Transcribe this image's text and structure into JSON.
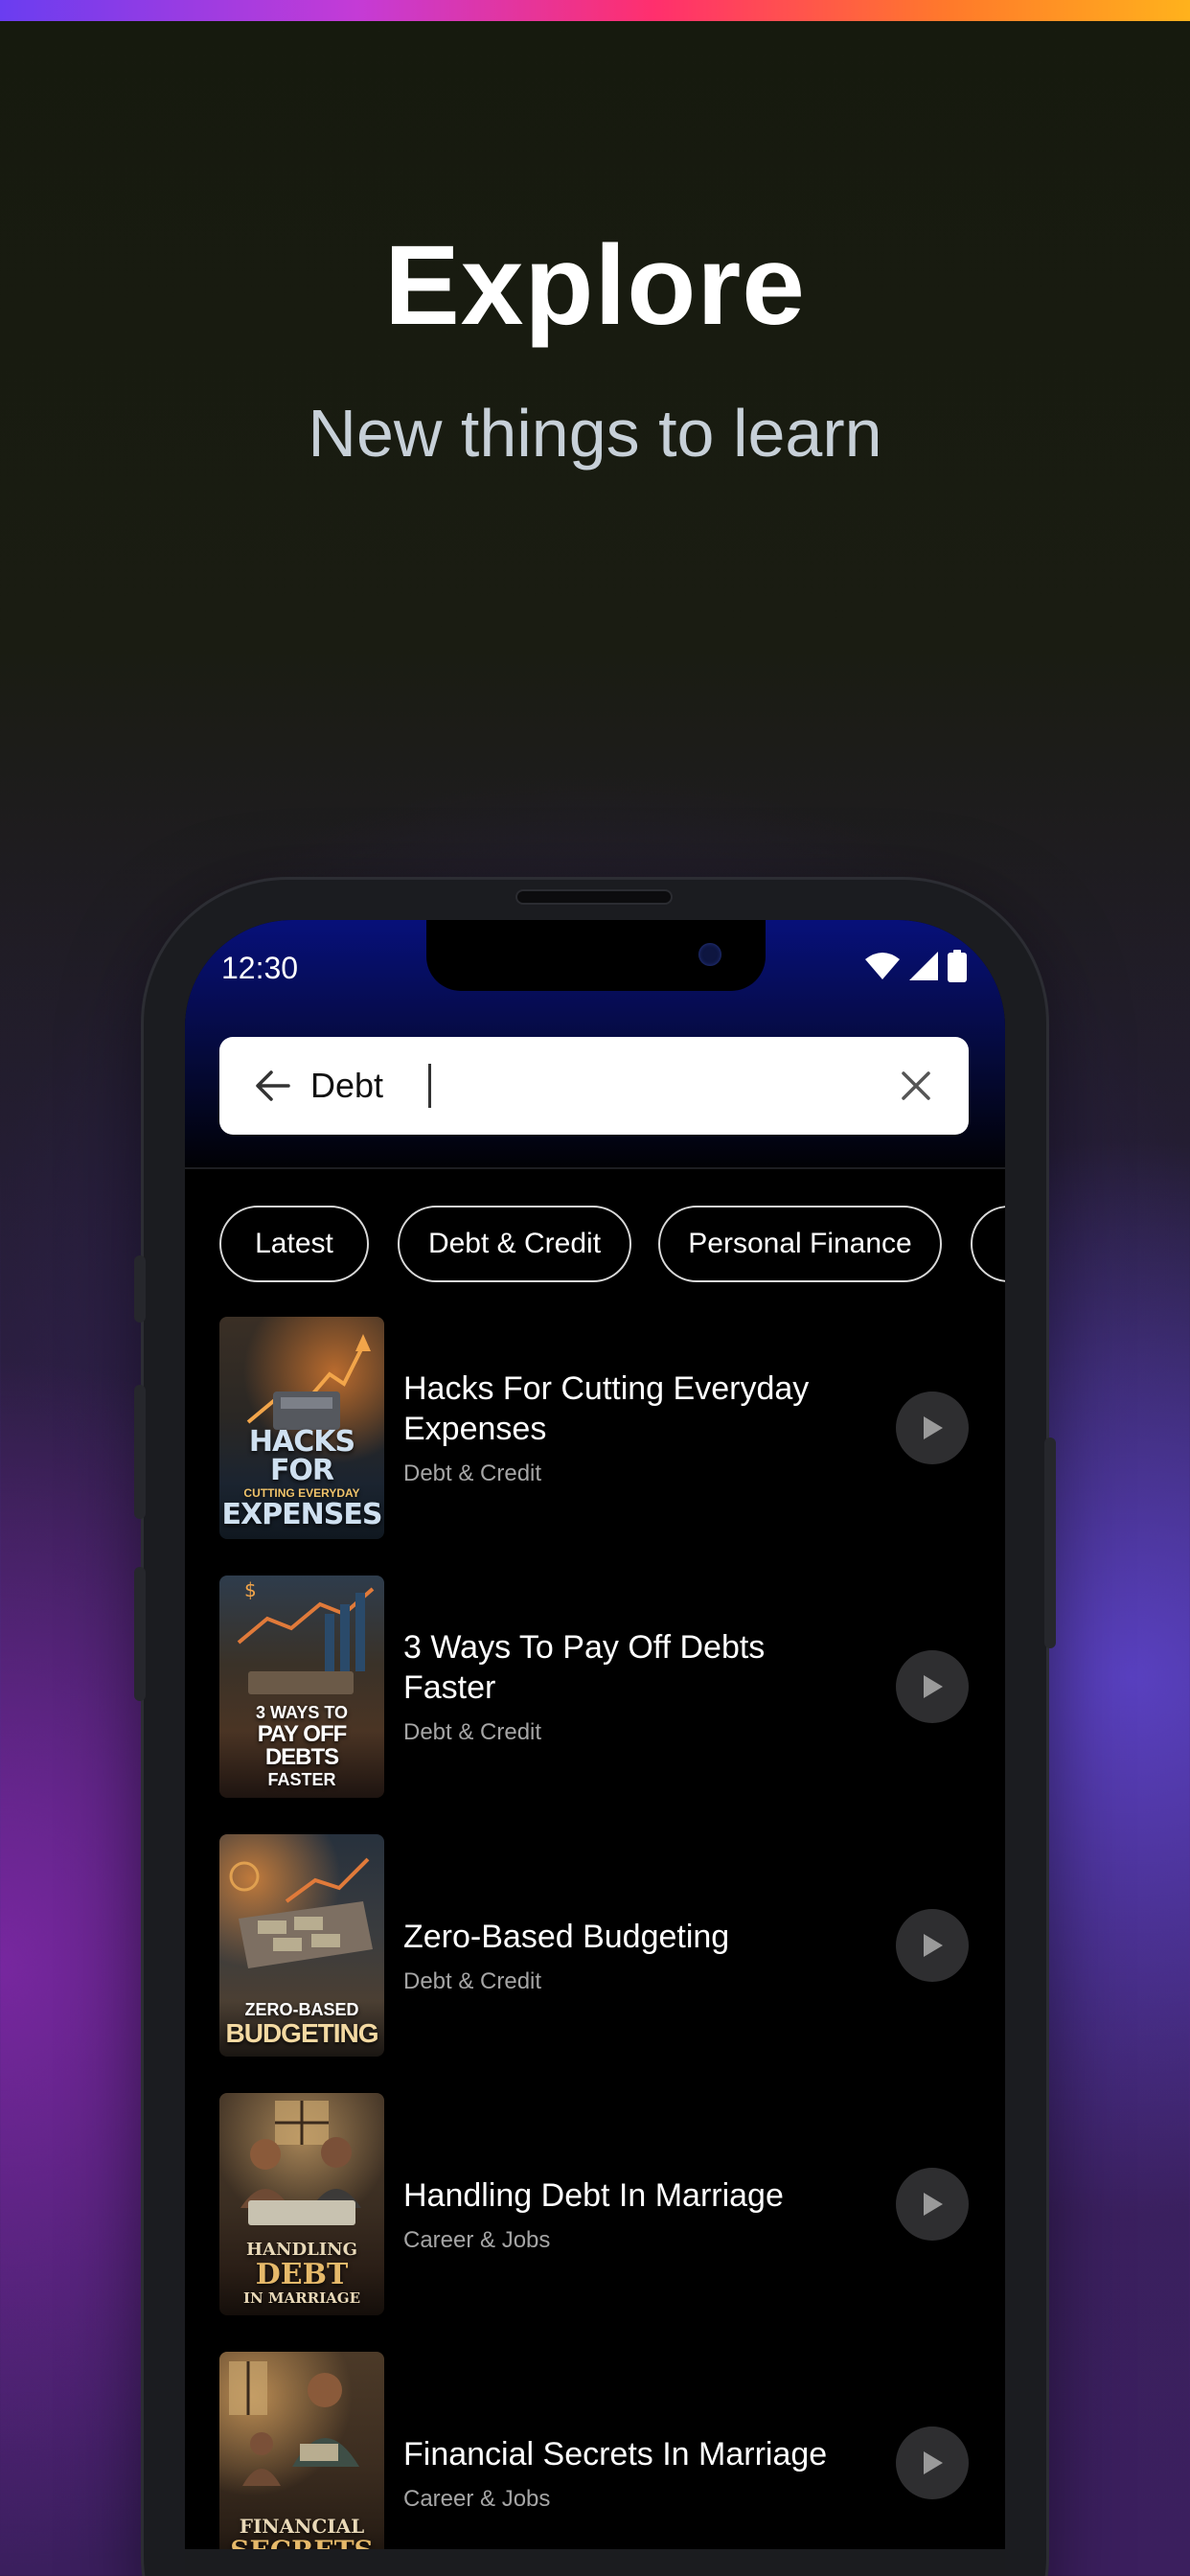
{
  "hero": {
    "title": "Explore",
    "subtitle": "New things to learn"
  },
  "status_bar": {
    "time": "12:30",
    "icons": [
      "wifi-icon",
      "cellular-signal-icon",
      "battery-icon"
    ]
  },
  "search": {
    "value": "Debt",
    "back_icon": "arrow-left-icon",
    "clear_icon": "close-icon"
  },
  "filters": [
    {
      "label": "Latest"
    },
    {
      "label": "Debt & Credit"
    },
    {
      "label": "Personal Finance"
    },
    {
      "label": ""
    }
  ],
  "results": [
    {
      "title": "Hacks For Cutting Everyday Expenses",
      "category": "Debt & Credit",
      "cover_text": [
        "HACKS FOR",
        "CUTTING EVERYDAY",
        "EXPENSES"
      ]
    },
    {
      "title": "3 Ways To Pay Off Debts Faster",
      "category": "Debt & Credit",
      "cover_text": [
        "3 WAYS TO",
        "PAY OFF DEBTS",
        "FASTER"
      ]
    },
    {
      "title": "Zero-Based Budgeting",
      "category": "Debt & Credit",
      "cover_text": [
        "ZERO-BASED",
        "BUDGETING"
      ]
    },
    {
      "title": "Handling Debt In Marriage",
      "category": "Career & Jobs",
      "cover_text": [
        "HANDLING",
        "DEBT",
        "IN MARRIAGE"
      ]
    },
    {
      "title": "Financial Secrets In Marriage",
      "category": "Career & Jobs",
      "cover_text": [
        "FINANCIAL",
        "SECRETS"
      ]
    }
  ],
  "colors": {
    "accent_gradient": [
      "#6a3df0",
      "#ff2f6d",
      "#ffb21c"
    ],
    "header_blue": "#07107a",
    "play_button": "#2e2e30"
  }
}
